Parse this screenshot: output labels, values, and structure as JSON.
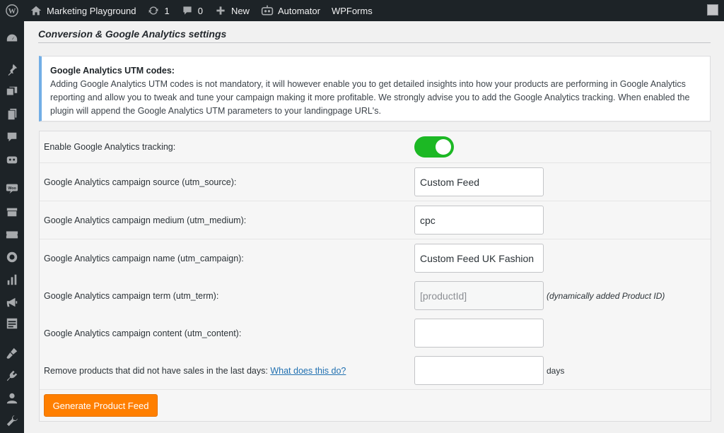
{
  "adminbar": {
    "site_name": "Marketing Playground",
    "updates_count": "1",
    "comments_count": "0",
    "new_label": "New",
    "automator_label": "Automator",
    "wpforms_label": "WPForms"
  },
  "sidebar": {
    "icons": [
      "dashboard-icon",
      "posts-icon",
      "media-icon",
      "pages-icon",
      "comments-icon",
      "automator-icon",
      "woocommerce-icon",
      "products-icon",
      "tickets-icon",
      "feed-icon",
      "analytics-icon",
      "marketing-icon",
      "forms-icon",
      "appearance-icon",
      "plugins-icon",
      "users-icon",
      "tools-icon"
    ]
  },
  "section": {
    "title": "Conversion & Google Analytics settings"
  },
  "notice": {
    "title": "Google Analytics UTM codes:",
    "line1": "Adding Google Analytics UTM codes is not mandatory, it will however enable you to get detailed insights into how your products are performing in Google Analytics",
    "line2": "reporting and allow you to tweak and tune your campaign making it more profitable. We strongly advise you to add the Google Analytics tracking. When enabled the",
    "line3": "plugin will append the Google Analytics UTM parameters to your landingpage URL's."
  },
  "settings": {
    "enable_tracking": {
      "label": "Enable Google Analytics tracking:",
      "enabled": true
    },
    "utm_source": {
      "label": "Google Analytics campaign source (utm_source):",
      "value": "Custom Feed"
    },
    "utm_medium": {
      "label": "Google Analytics campaign medium (utm_medium):",
      "value": "cpc"
    },
    "utm_campaign": {
      "label": "Google Analytics campaign name (utm_campaign):",
      "value": "Custom Feed UK Fashion"
    },
    "utm_term": {
      "label": "Google Analytics campaign term (utm_term):",
      "value": "[productId]",
      "note": "(dynamically added Product ID)"
    },
    "utm_content": {
      "label": "Google Analytics campaign content (utm_content):",
      "value": ""
    },
    "remove_products": {
      "label": "Remove products that did not have sales in the last days:",
      "link": "What does this do?",
      "value": "",
      "unit": "days"
    }
  },
  "actions": {
    "generate_label": "Generate Product Feed"
  },
  "colors": {
    "toggle_on": "#1cb824",
    "primary_button": "#ff7f00",
    "notice_border": "#72aee6",
    "adminbar_bg": "#1d2327"
  }
}
